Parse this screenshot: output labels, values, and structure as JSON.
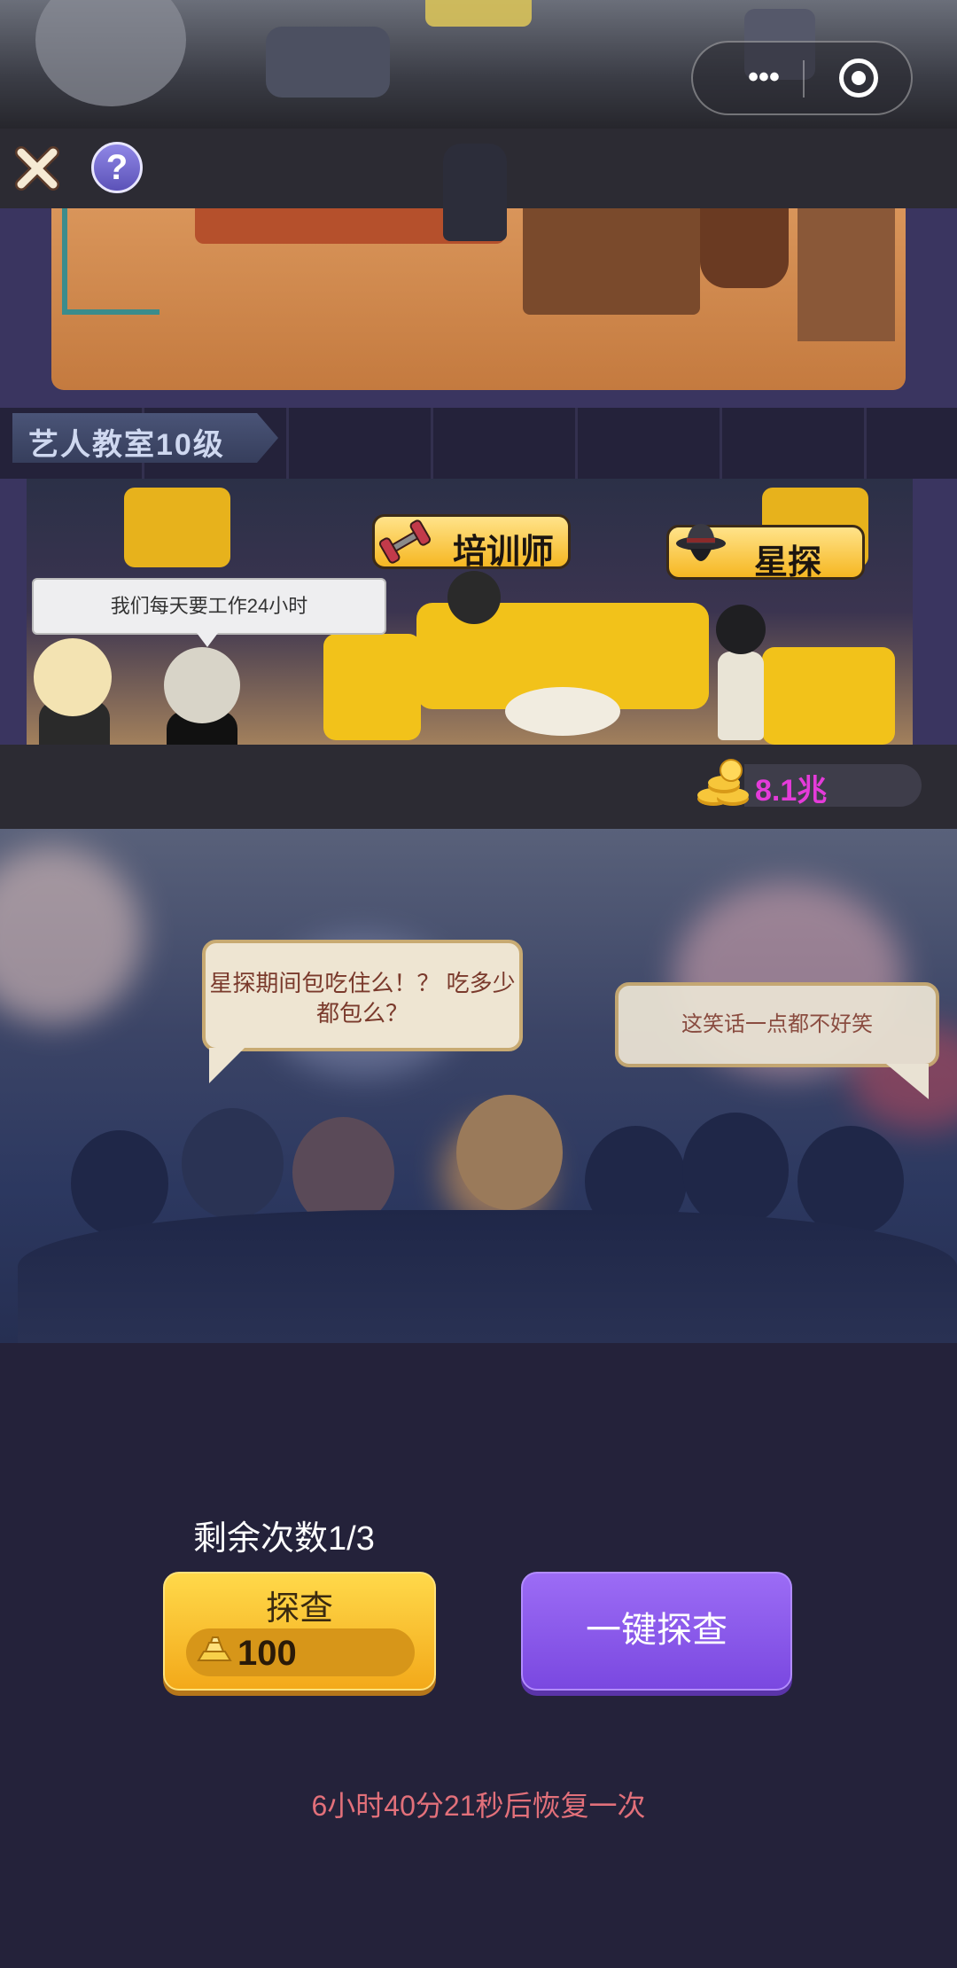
{
  "header": {
    "menu_icon": "more-dots-icon",
    "close_app_icon": "target-circle-icon",
    "close_icon": "close-x-icon",
    "help_icon": "question-icon",
    "help_label": "?",
    "menu_dots": "•••"
  },
  "building": {
    "floor_label": "艺人教室10级",
    "roles": [
      {
        "label": "培训师",
        "icon": "dumbbell-icon"
      },
      {
        "label": "星探",
        "icon": "detective-hat-icon"
      }
    ],
    "speech": "我们每天要工作24小时"
  },
  "currency": {
    "icon": "gold-coin-stack-icon",
    "value": "8.1兆",
    "color": "#e43bd9"
  },
  "scene": {
    "bubble_left": "星探期间包吃住么！？ 吃多少都包么？",
    "bubble_right": "这笑话一点都不好笑"
  },
  "panel": {
    "remaining": "剩余次数1/3",
    "investigate_label": "探查",
    "investigate_cost": "100",
    "cost_icon": "gold-ingot-icon",
    "one_key_label": "一键探查",
    "recover_text": "6小时40分21秒后恢复一次"
  },
  "colors": {
    "accent_gold": "#f3a91a",
    "accent_purple": "#7a48e0",
    "recover_red": "#e2707a",
    "background": "#24223a"
  }
}
